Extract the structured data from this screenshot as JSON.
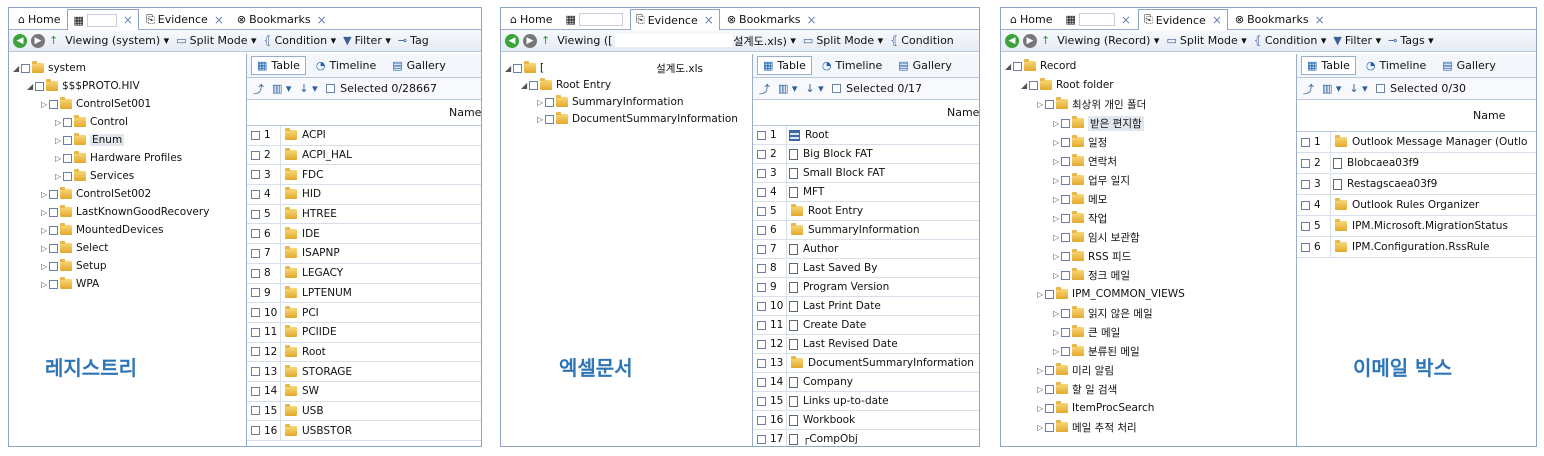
{
  "tabs": {
    "home": "Home",
    "evidence": "Evidence",
    "bookmarks": "Bookmarks",
    "close": "×"
  },
  "panel1": {
    "viewing": "Viewing (system)",
    "split": "Split Mode",
    "condition": "Condition",
    "filter": "Filter",
    "tags": "Tag",
    "tree": [
      {
        "label": "system",
        "depth": 0,
        "icon": "root"
      },
      {
        "label": "$$$PROTO.HIV",
        "depth": 1,
        "icon": "folder"
      },
      {
        "label": "ControlSet001",
        "depth": 2,
        "icon": "folder"
      },
      {
        "label": "Control",
        "depth": 3,
        "icon": "folder"
      },
      {
        "label": "Enum",
        "depth": 3,
        "icon": "folder",
        "selected": true
      },
      {
        "label": "Hardware Profiles",
        "depth": 3,
        "icon": "folder"
      },
      {
        "label": "Services",
        "depth": 3,
        "icon": "folder"
      },
      {
        "label": "ControlSet002",
        "depth": 2,
        "icon": "folder"
      },
      {
        "label": "LastKnownGoodRecovery",
        "depth": 2,
        "icon": "folder"
      },
      {
        "label": "MountedDevices",
        "depth": 2,
        "icon": "folder"
      },
      {
        "label": "Select",
        "depth": 2,
        "icon": "folder"
      },
      {
        "label": "Setup",
        "depth": 2,
        "icon": "folder"
      },
      {
        "label": "WPA",
        "depth": 2,
        "icon": "folder"
      }
    ],
    "selected": "Selected 0/28667",
    "column": "Name",
    "rows": [
      "ACPI",
      "ACPI_HAL",
      "FDC",
      "HID",
      "HTREE",
      "IDE",
      "ISAPNP",
      "LEGACY",
      "LPTENUM",
      "PCI",
      "PCIIDE",
      "Root",
      "STORAGE",
      "SW",
      "USB",
      "USBSTOR"
    ],
    "caption": "레지스트리"
  },
  "panel2": {
    "viewing": "Viewing ([",
    "viewing_suffix": "설계도.xls)",
    "split": "Split Mode",
    "condition": "Condition",
    "tree": [
      {
        "label": "[",
        "depth": 0,
        "icon": "root",
        "suffix": "설계도.xls"
      },
      {
        "label": "Root Entry",
        "depth": 1,
        "icon": "folder"
      },
      {
        "label": "SummaryInformation",
        "depth": 2,
        "icon": "folder"
      },
      {
        "label": "DocumentSummaryInformation",
        "depth": 2,
        "icon": "folder"
      }
    ],
    "selected": "Selected 0/17",
    "column": "Name",
    "rows": [
      {
        "n": "Root",
        "t": "grid"
      },
      {
        "n": "Big Block FAT",
        "t": "doc"
      },
      {
        "n": "Small Block FAT",
        "t": "doc"
      },
      {
        "n": "MFT",
        "t": "doc"
      },
      {
        "n": "Root Entry",
        "t": "folder"
      },
      {
        "n": "SummaryInformation",
        "t": "folder"
      },
      {
        "n": "Author",
        "t": "doc"
      },
      {
        "n": "Last Saved By",
        "t": "doc"
      },
      {
        "n": "Program Version",
        "t": "doc"
      },
      {
        "n": "Last Print Date",
        "t": "doc"
      },
      {
        "n": "Create Date",
        "t": "doc"
      },
      {
        "n": "Last Revised Date",
        "t": "doc"
      },
      {
        "n": "DocumentSummaryInformation",
        "t": "folder"
      },
      {
        "n": "Company",
        "t": "doc"
      },
      {
        "n": "Links up-to-date",
        "t": "doc"
      },
      {
        "n": "Workbook",
        "t": "doc"
      },
      {
        "n": "┌CompObj",
        "t": "doc"
      }
    ],
    "caption": "엑셀문서"
  },
  "panel3": {
    "viewing": "Viewing (Record)",
    "split": "Split Mode",
    "condition": "Condition",
    "filter": "Filter",
    "tags": "Tags",
    "tree": [
      {
        "label": "Record",
        "depth": 0,
        "icon": "root"
      },
      {
        "label": "Root folder",
        "depth": 1,
        "icon": "folder"
      },
      {
        "label": "최상위 개인 폴더",
        "depth": 2,
        "icon": "folder"
      },
      {
        "label": "받은 편지함",
        "depth": 3,
        "icon": "folder",
        "selected": true
      },
      {
        "label": "일정",
        "depth": 3,
        "icon": "folder"
      },
      {
        "label": "연락처",
        "depth": 3,
        "icon": "folder"
      },
      {
        "label": "업무 일지",
        "depth": 3,
        "icon": "folder"
      },
      {
        "label": "메모",
        "depth": 3,
        "icon": "folder"
      },
      {
        "label": "작업",
        "depth": 3,
        "icon": "folder"
      },
      {
        "label": "임시 보관함",
        "depth": 3,
        "icon": "folder"
      },
      {
        "label": "RSS 피드",
        "depth": 3,
        "icon": "folder"
      },
      {
        "label": "정크 메일",
        "depth": 3,
        "icon": "folder"
      },
      {
        "label": "IPM_COMMON_VIEWS",
        "depth": 2,
        "icon": "folder"
      },
      {
        "label": "읽지 않은 메일",
        "depth": 3,
        "icon": "folder"
      },
      {
        "label": "큰 메일",
        "depth": 3,
        "icon": "folder"
      },
      {
        "label": "분류된 메일",
        "depth": 3,
        "icon": "folder"
      },
      {
        "label": "미리 알림",
        "depth": 2,
        "icon": "folder"
      },
      {
        "label": "할 일 검색",
        "depth": 2,
        "icon": "folder"
      },
      {
        "label": "ItemProcSearch",
        "depth": 2,
        "icon": "folder"
      },
      {
        "label": "메일 추적 처리",
        "depth": 2,
        "icon": "folder"
      }
    ],
    "selected": "Selected 0/30",
    "column": "Name",
    "rows": [
      {
        "n": "Outlook Message Manager (Outlo",
        "t": "folder"
      },
      {
        "n": "Blobcaea03f9",
        "t": "doc"
      },
      {
        "n": "Restagscaea03f9",
        "t": "doc"
      },
      {
        "n": "Outlook Rules Organizer",
        "t": "folder"
      },
      {
        "n": "IPM.Microsoft.MigrationStatus",
        "t": "folder"
      },
      {
        "n": "IPM.Configuration.RssRule",
        "t": "folder"
      }
    ],
    "caption": "이메일 박스"
  },
  "views": {
    "table": "Table",
    "timeline": "Timeline",
    "gallery": "Gallery"
  },
  "colors": {
    "border": "#8ca4c6",
    "caption": "#2e75b6",
    "folder": "#e2a82c"
  }
}
